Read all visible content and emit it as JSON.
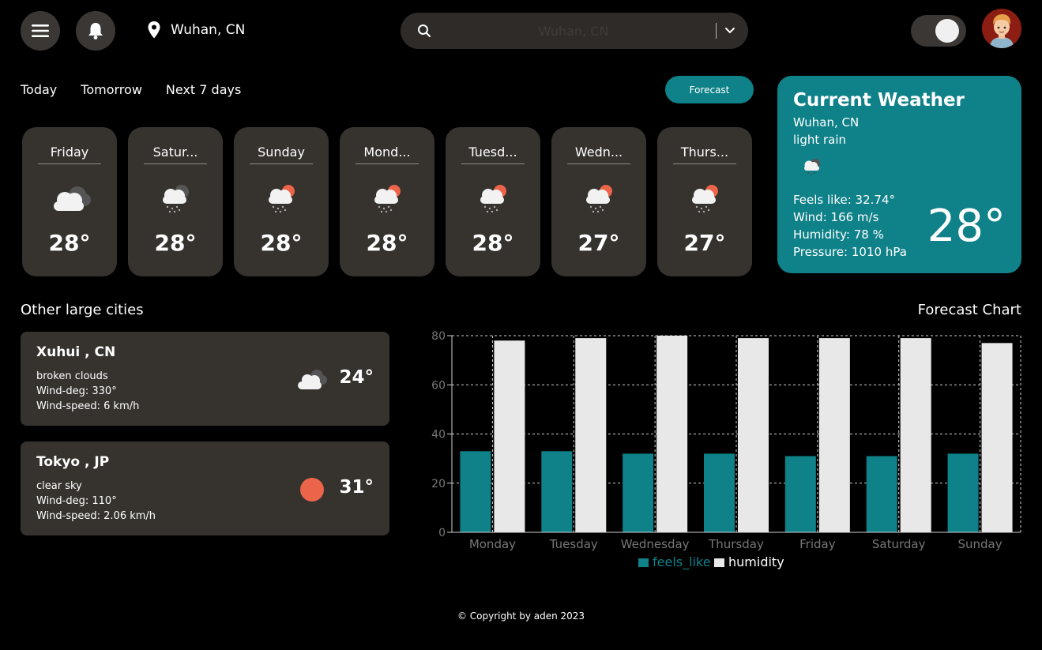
{
  "header": {
    "menu_icon": "hamburger-icon",
    "bell_icon": "bell-icon",
    "location_icon": "map-pin-icon",
    "location": "Wuhan, CN",
    "search_placeholder": "Wuhan, CN"
  },
  "tabs": [
    "Today",
    "Tomorrow",
    "Next 7 days"
  ],
  "forecast_button": "Forecast",
  "days": [
    {
      "name": "Friday",
      "temp": "28°",
      "icon": "cloudy-icon"
    },
    {
      "name": "Satur...",
      "temp": "28°",
      "icon": "rain-cloud-icon"
    },
    {
      "name": "Sunday",
      "temp": "28°",
      "icon": "sun-rain-icon"
    },
    {
      "name": "Mond...",
      "temp": "28°",
      "icon": "sun-rain-icon"
    },
    {
      "name": "Tuesd...",
      "temp": "28°",
      "icon": "sun-rain-icon"
    },
    {
      "name": "Wedn...",
      "temp": "27°",
      "icon": "sun-rain-icon"
    },
    {
      "name": "Thurs...",
      "temp": "27°",
      "icon": "sun-rain-icon"
    }
  ],
  "current": {
    "title": "Current Weather",
    "city": "Wuhan, CN",
    "description": "light rain",
    "feels_like": "Feels like: 32.74°",
    "wind": "Wind: 166 m/s",
    "humidity": "Humidity: 78 %",
    "pressure": "Pressure: 1010 hPa",
    "temp": "28°"
  },
  "other_cities_title": "Other large cities",
  "cities": [
    {
      "name": "Xuhui , CN",
      "description": "broken clouds",
      "wind_deg": "Wind-deg: 330°",
      "wind_speed": "Wind-speed: 6 km/h",
      "temp": "24°",
      "icon": "broken-clouds-icon"
    },
    {
      "name": "Tokyo , JP",
      "description": "clear sky",
      "wind_deg": "Wind-deg: 110°",
      "wind_speed": "Wind-speed: 2.06 km/h",
      "temp": "31°",
      "icon": "sun-icon"
    }
  ],
  "chart_title": "Forecast Chart",
  "chart_data": {
    "type": "bar",
    "categories": [
      "Monday",
      "Tuesday",
      "Wednesday",
      "Thursday",
      "Friday",
      "Saturday",
      "Sunday"
    ],
    "series": [
      {
        "name": "feels_like",
        "values": [
          33,
          33,
          32,
          32,
          31,
          31,
          32
        ],
        "color": "#0f8189"
      },
      {
        "name": "humidity",
        "values": [
          78,
          79,
          81,
          79,
          79,
          79,
          77
        ],
        "color": "#e8e8e8"
      }
    ],
    "ylim": [
      0,
      80
    ],
    "yticks": [
      0,
      20,
      40,
      60,
      80
    ],
    "grid": true,
    "legend": "bottom"
  },
  "copyright": "© Copyright by aden 2023"
}
